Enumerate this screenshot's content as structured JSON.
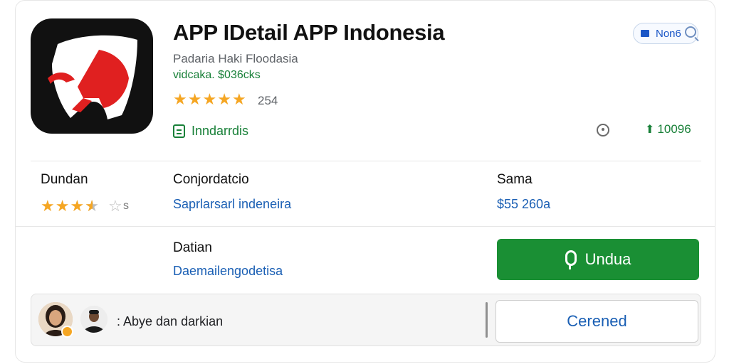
{
  "app": {
    "title": "APP IDetail APP Indonesia",
    "developer": "Padaria Haki Floodasia",
    "developer_sub": "vidcaka. $036cks",
    "rating_count": "254",
    "tag": "Inndarrdis",
    "downloads": "10096"
  },
  "top_button": {
    "label": "Non6"
  },
  "details": {
    "col1": {
      "label": "Dundan",
      "count": "s"
    },
    "col2": {
      "label": "Conjordatcio",
      "value": "Saprlarsarl indeneira"
    },
    "col3": {
      "label": "Sama",
      "value": "$55 260a"
    },
    "row2": {
      "label": "Datian",
      "value": "Daemailengodetisa"
    }
  },
  "buttons": {
    "install": "Undua",
    "cancel": "Cerened"
  },
  "comment": {
    "text": ": Abye dan darkian"
  },
  "ratings": {
    "app_stars": 5,
    "detail_stars": 3.5
  },
  "colors": {
    "accent_green": "#1a8f34",
    "link_blue": "#1a5fb4",
    "star": "#f5a623",
    "icon_red": "#e02020"
  },
  "icons": [
    "app-logo",
    "book-icon",
    "info-icon",
    "download-arrow-icon",
    "search-icon",
    "mic-icon"
  ]
}
